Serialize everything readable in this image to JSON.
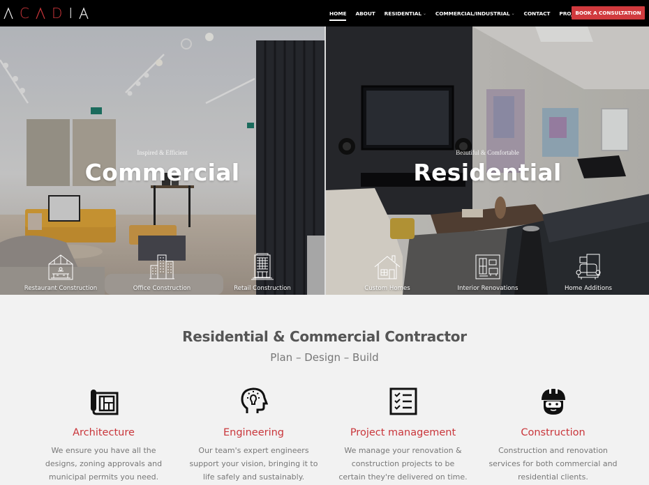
{
  "header": {
    "logo": {
      "letters": [
        "C",
        "A",
        "D",
        "I",
        "A"
      ],
      "brand": "ACADIA"
    },
    "nav": [
      {
        "label": "HOME",
        "active": true,
        "dropdown": false
      },
      {
        "label": "ABOUT",
        "active": false,
        "dropdown": false
      },
      {
        "label": "RESIDENTIAL",
        "active": false,
        "dropdown": true
      },
      {
        "label": "COMMERCIAL/INDUSTRIAL",
        "active": false,
        "dropdown": true
      },
      {
        "label": "CONTACT",
        "active": false,
        "dropdown": false
      },
      {
        "label": "PROJECTS",
        "active": false,
        "dropdown": false
      }
    ],
    "cta_label": "BOOK A CONSULTATION",
    "caret": "⌄"
  },
  "hero": {
    "commercial": {
      "eyebrow": "Inspired & Efficient",
      "title": "Commercial",
      "items": [
        {
          "label": "Restaurant Construction",
          "icon": "restaurant-icon"
        },
        {
          "label": "Office Construction",
          "icon": "office-buildings-icon"
        },
        {
          "label": "Retail Construction",
          "icon": "retail-building-icon"
        }
      ]
    },
    "residential": {
      "eyebrow": "Beautiful & Comfortable",
      "title": "Residential",
      "items": [
        {
          "label": "Custom Homes",
          "icon": "house-icon"
        },
        {
          "label": "Interior Renovations",
          "icon": "interior-icon"
        },
        {
          "label": "Home Additions",
          "icon": "armchair-icon"
        }
      ]
    }
  },
  "intro": {
    "title": "Residential & Commercial Contractor",
    "subtitle": "Plan – Design – Build"
  },
  "services": [
    {
      "title": "Architecture",
      "description": "We ensure you have all the designs, zoning approvals and municipal permits you need.",
      "icon": "blueprint-icon"
    },
    {
      "title": "Engineering",
      "description": "Our team's expert engineers support your vision, bringing it to life safely and sustainably.",
      "icon": "head-lightbulb-icon"
    },
    {
      "title": "Project management",
      "description": "We manage your renovation & construction projects to be certain they're delivered on time.",
      "icon": "checklist-icon"
    },
    {
      "title": "Construction",
      "description": "Construction and renovation services for both commercial and residential clients.",
      "icon": "worker-helmet-icon"
    }
  ],
  "colors": {
    "accent": "#d13a3e",
    "header_bg": "#000000",
    "page_bg": "#f2f2f2"
  }
}
